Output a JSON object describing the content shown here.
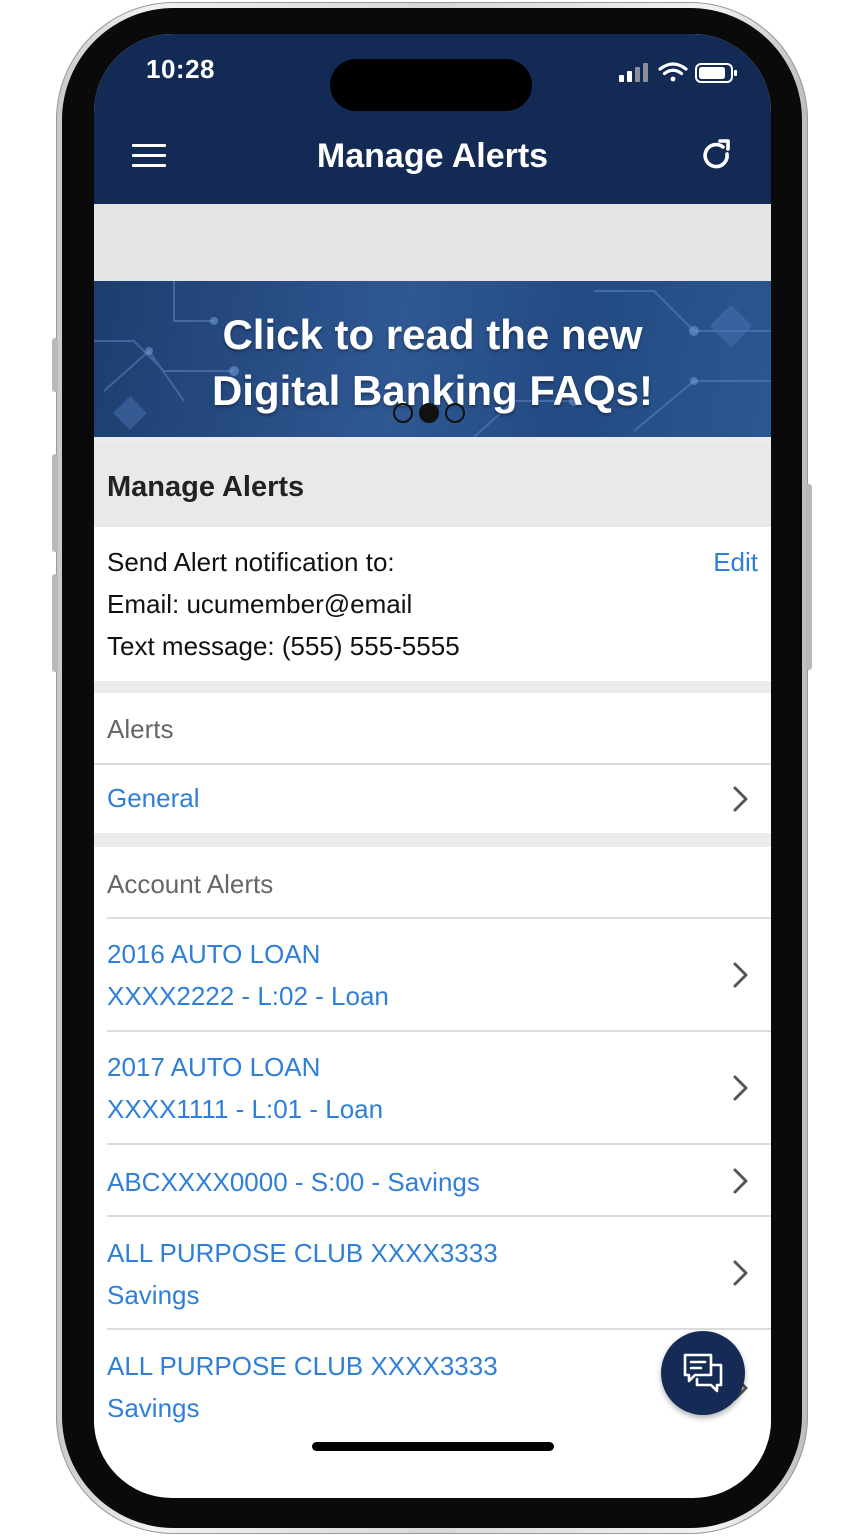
{
  "status_bar": {
    "time": "10:28"
  },
  "header": {
    "title": "Manage Alerts",
    "menu_icon": "hamburger-menu-icon",
    "refresh_icon": "refresh-icon"
  },
  "banner": {
    "line1": "Click to read the new",
    "line2": "Digital Banking FAQs!",
    "dots": {
      "count": 3,
      "active_index": 1
    }
  },
  "section": {
    "title": "Manage Alerts"
  },
  "notification": {
    "label": "Send Alert notification to:",
    "edit_label": "Edit",
    "email": "Email: ucumember@email",
    "text_message": "Text message: (555) 555-5555"
  },
  "alerts": {
    "label": "Alerts",
    "items": [
      {
        "label": "General"
      }
    ]
  },
  "account_alerts": {
    "label": "Account Alerts",
    "items": [
      {
        "line1": "2016  AUTO LOAN",
        "line2": "XXXX2222  - L:02 - Loan"
      },
      {
        "line1": "2017  AUTO LOAN",
        "line2": "XXXX1111   - L:01 - Loan"
      },
      {
        "line1": "ABCXXXX0000  - S:00 - Savings",
        "line2": ""
      },
      {
        "line1": "ALL PURPOSE CLUB XXXX3333",
        "line2": "Savings"
      },
      {
        "line1": "ALL PURPOSE CLUB XXXX3333",
        "line2": "Savings"
      }
    ]
  },
  "chat_button": {
    "icon": "chat-icon"
  },
  "colors": {
    "header_bg": "#132a54",
    "link": "#2f7fd8",
    "fab_bg": "#152b55"
  }
}
